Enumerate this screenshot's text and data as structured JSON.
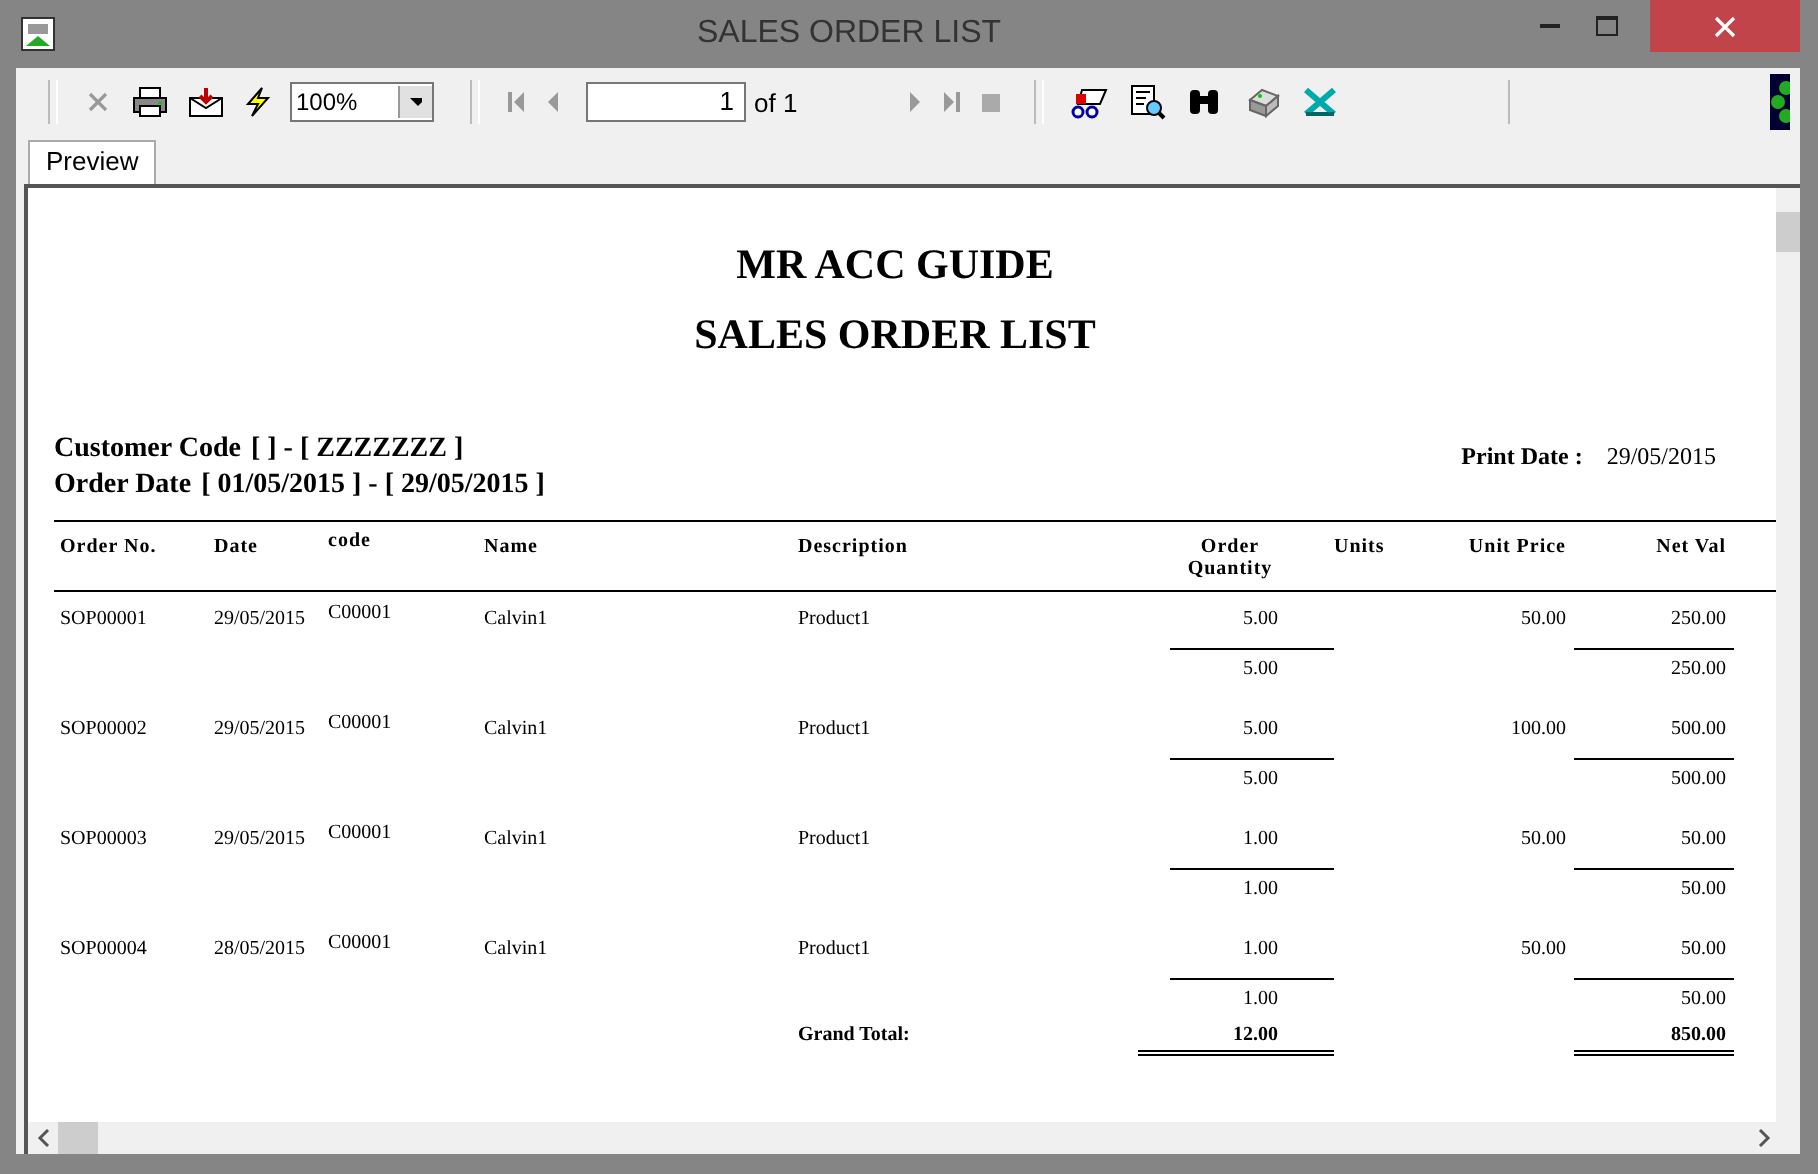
{
  "window": {
    "title": "SALES ORDER LIST"
  },
  "toolbar": {
    "zoom": "100%",
    "page": "1",
    "page_count": "of 1"
  },
  "tabs": [
    {
      "label": "Preview",
      "selected": true
    }
  ],
  "report": {
    "company": "MR ACC GUIDE",
    "title": "SALES ORDER LIST",
    "customer_code_label": "Customer Code",
    "customer_code_range": "[  ] - [ ZZZZZZZ ]",
    "order_date_label": "Order Date",
    "order_date_range": "[ 01/05/2015 ]  -  [ 29/05/2015 ]",
    "print_date_label": "Print Date :",
    "print_date": "29/05/2015",
    "columns": [
      "Order No.",
      "Date",
      "code",
      "Name",
      "Description",
      "Order Quantity",
      "Units",
      "Unit Price",
      "Net Val"
    ],
    "orders": [
      {
        "order_no": "SOP00001",
        "date": "29/05/2015",
        "code": "C00001",
        "name": "Calvin1",
        "description": "Product1",
        "quantity": "5.00",
        "unit_price": "50.00",
        "net_value": "250.00",
        "subtotal_quantity": "5.00",
        "subtotal_net_value": "250.00"
      },
      {
        "order_no": "SOP00002",
        "date": "29/05/2015",
        "code": "C00001",
        "name": "Calvin1",
        "description": "Product1",
        "quantity": "5.00",
        "unit_price": "100.00",
        "net_value": "500.00",
        "subtotal_quantity": "5.00",
        "subtotal_net_value": "500.00"
      },
      {
        "order_no": "SOP00003",
        "date": "29/05/2015",
        "code": "C00001",
        "name": "Calvin1",
        "description": "Product1",
        "quantity": "1.00",
        "unit_price": "50.00",
        "net_value": "50.00",
        "subtotal_quantity": "1.00",
        "subtotal_net_value": "50.00"
      },
      {
        "order_no": "SOP00004",
        "date": "28/05/2015",
        "code": "C00001",
        "name": "Calvin1",
        "description": "Product1",
        "quantity": "1.00",
        "unit_price": "50.00",
        "net_value": "50.00",
        "subtotal_quantity": "1.00",
        "subtotal_net_value": "50.00"
      }
    ],
    "grand_total": {
      "label": "Grand Total:",
      "quantity": "12.00",
      "net_value": "850.00"
    }
  }
}
